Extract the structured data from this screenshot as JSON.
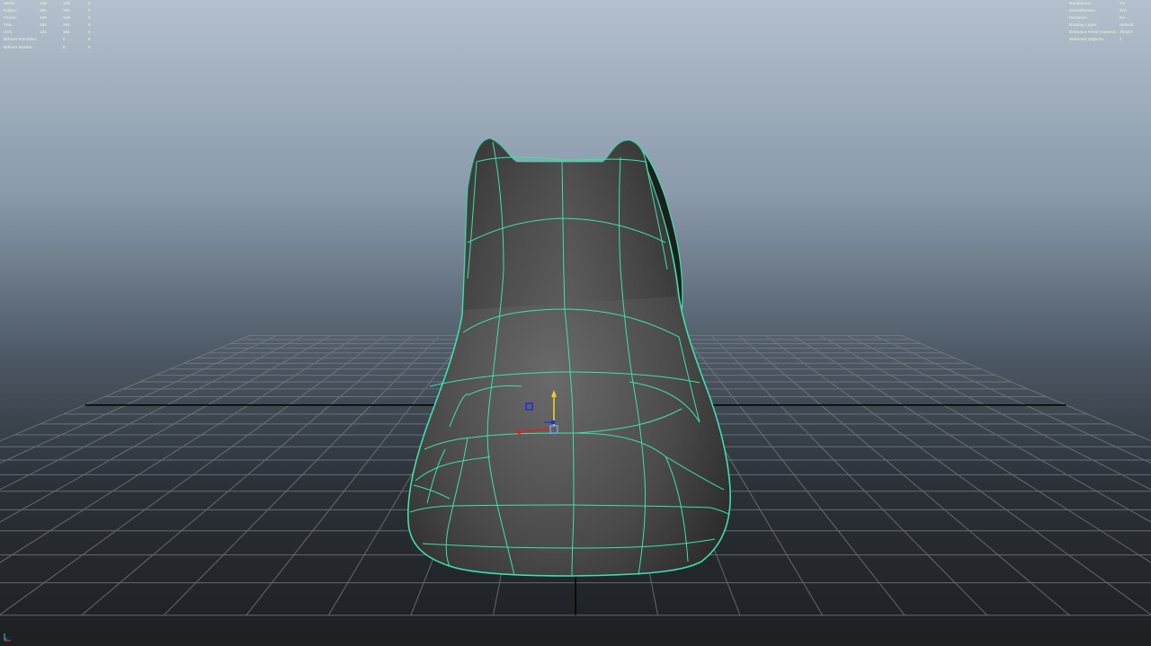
{
  "colors": {
    "hud_text": "#d9ebd6",
    "wireframe": "#3fe0a8",
    "mesh_shade": "#505050",
    "grid_line": "#7a7f84",
    "grid_axis": "#050505",
    "manip_y": "#f0d020",
    "manip_x": "#e02020",
    "manip_z": "#2030d0",
    "manip_center": "#6ab4ff"
  },
  "hud_left": {
    "rows": [
      {
        "label": "Verts:",
        "v1": "148",
        "v2": "148",
        "v3": "0"
      },
      {
        "label": "Edges:",
        "v1": "292",
        "v2": "292",
        "v3": "0"
      },
      {
        "label": "Faces:",
        "v1": "146",
        "v2": "146",
        "v3": "0"
      },
      {
        "label": "Tris:",
        "v1": "292",
        "v2": "292",
        "v3": "0"
      },
      {
        "label": "UVs:",
        "v1": "181",
        "v2": "181",
        "v3": "0"
      },
      {
        "label": "Bifrost Particles:",
        "v1": "",
        "v2": "0",
        "v3": "0"
      },
      {
        "label": "Bifrost Voxels:",
        "v1": "",
        "v2": "0",
        "v3": "0"
      }
    ]
  },
  "hud_right": {
    "rows": [
      {
        "label": "Backfaces:",
        "value": "On"
      },
      {
        "label": "Smoothness:",
        "value": "N/A"
      },
      {
        "label": "Instance:",
        "value": "No"
      },
      {
        "label": "Display Layer:",
        "value": "default"
      },
      {
        "label": "Distance From Camera:",
        "value": "29.837"
      },
      {
        "label": "Selected Objects:",
        "value": "1"
      }
    ]
  },
  "viewport": {
    "object": "polygon-mesh-seat",
    "manipulator": "move-tool"
  }
}
